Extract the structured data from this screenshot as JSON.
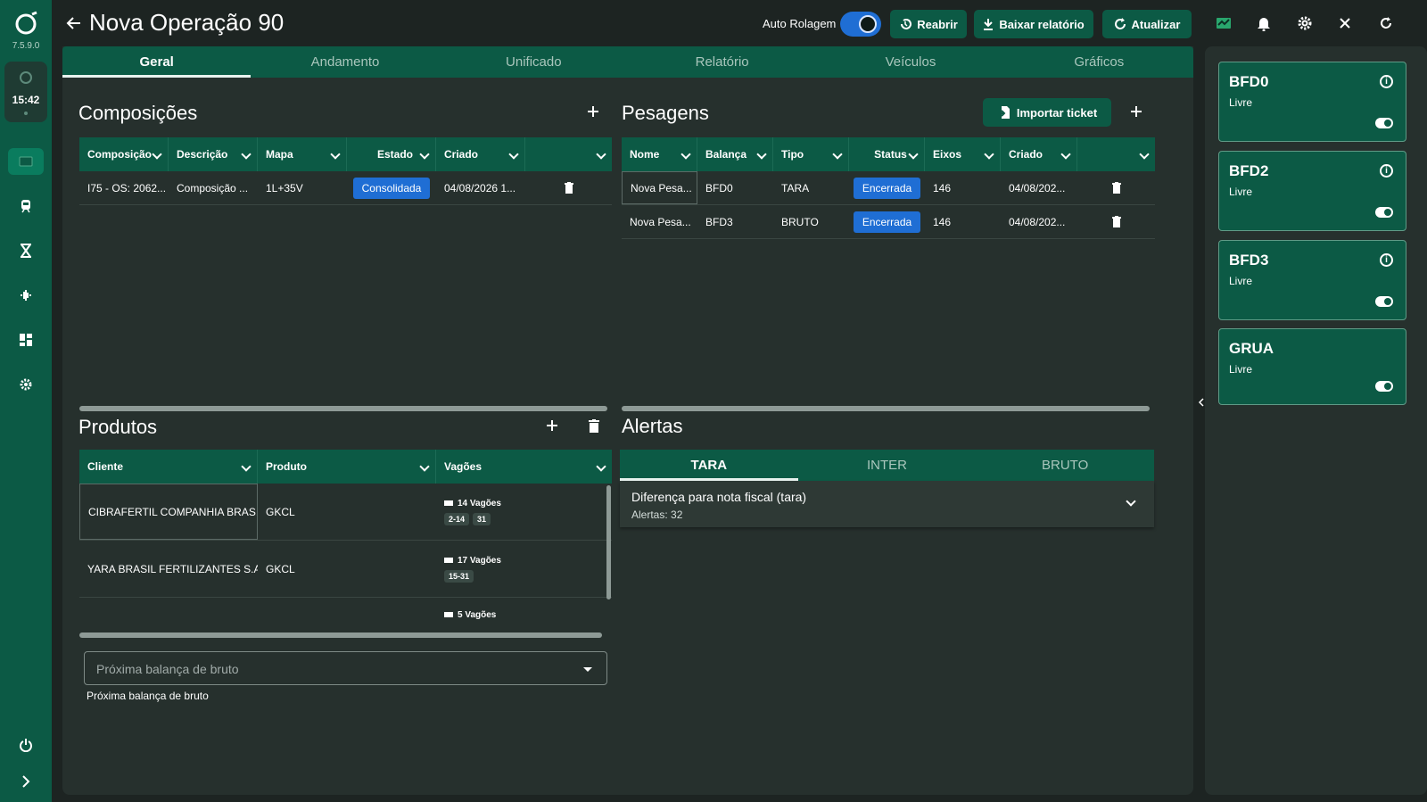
{
  "app": {
    "version": "7.5.9.0",
    "time": "15:42"
  },
  "header": {
    "title": "Nova Operação 90",
    "auto_scroll_label": "Auto Rolagem",
    "buttons": {
      "reopen": "Reabrir",
      "download_report": "Baixar relatório",
      "refresh": "Atualizar"
    }
  },
  "tabs": [
    "Geral",
    "Andamento",
    "Unificado",
    "Relatório",
    "Veículos",
    "Gráficos"
  ],
  "composicoes": {
    "title": "Composições",
    "columns": [
      "Composição",
      "Descrição",
      "Mapa",
      "Estado",
      "Criado",
      ""
    ],
    "rows": [
      {
        "composicao": "I75 - OS: 2062...",
        "descricao": "Composição ...",
        "mapa": "1L+35V",
        "estado": "Consolidada",
        "criado": "04/08/2026 1..."
      }
    ]
  },
  "pesagens": {
    "title": "Pesagens",
    "import_label": "Importar ticket",
    "columns": [
      "Nome",
      "Balança",
      "Tipo",
      "Status",
      "Eixos",
      "Criado",
      ""
    ],
    "rows": [
      {
        "nome": "Nova Pesa...",
        "balanca": "BFD0",
        "tipo": "TARA",
        "status": "Encerrada",
        "eixos": "146",
        "criado": "04/08/202..."
      },
      {
        "nome": "Nova Pesa...",
        "balanca": "BFD3",
        "tipo": "BRUTO",
        "status": "Encerrada",
        "eixos": "146",
        "criado": "04/08/202..."
      }
    ]
  },
  "produtos": {
    "title": "Produtos",
    "columns": [
      "Cliente",
      "Produto",
      "Vagões"
    ],
    "rows": [
      {
        "cliente": "CIBRAFERTIL COMPANHIA BRAS...",
        "produto": "GKCL",
        "vagoes": "14 Vagões",
        "chips": [
          "2-14",
          "31"
        ]
      },
      {
        "cliente": "YARA BRASIL FERTILIZANTES S.A.",
        "produto": "GKCL",
        "vagoes": "17 Vagões",
        "chips": [
          "15-31"
        ]
      },
      {
        "cliente": "",
        "produto": "",
        "vagoes": "5 Vagões",
        "chips": []
      }
    ],
    "select_placeholder": "Próxima balança de bruto",
    "select_helper": "Próxima balança de bruto"
  },
  "alertas": {
    "title": "Alertas",
    "tabs": [
      "TARA",
      "INTER",
      "BRUTO"
    ],
    "items": [
      {
        "title": "Diferença para nota fiscal (tara)",
        "subtitle": "Alertas: 32"
      }
    ]
  },
  "scales": [
    {
      "name": "BFD0",
      "status": "Livre",
      "info": true
    },
    {
      "name": "BFD2",
      "status": "Livre",
      "info": true
    },
    {
      "name": "BFD3",
      "status": "Livre",
      "info": true
    },
    {
      "name": "GRUA",
      "status": "Livre",
      "info": false
    }
  ],
  "colors": {
    "primary": "#0c5a45",
    "background": "#1d2422",
    "panel": "#26302d",
    "badge_blue": "#1f6ed4"
  }
}
